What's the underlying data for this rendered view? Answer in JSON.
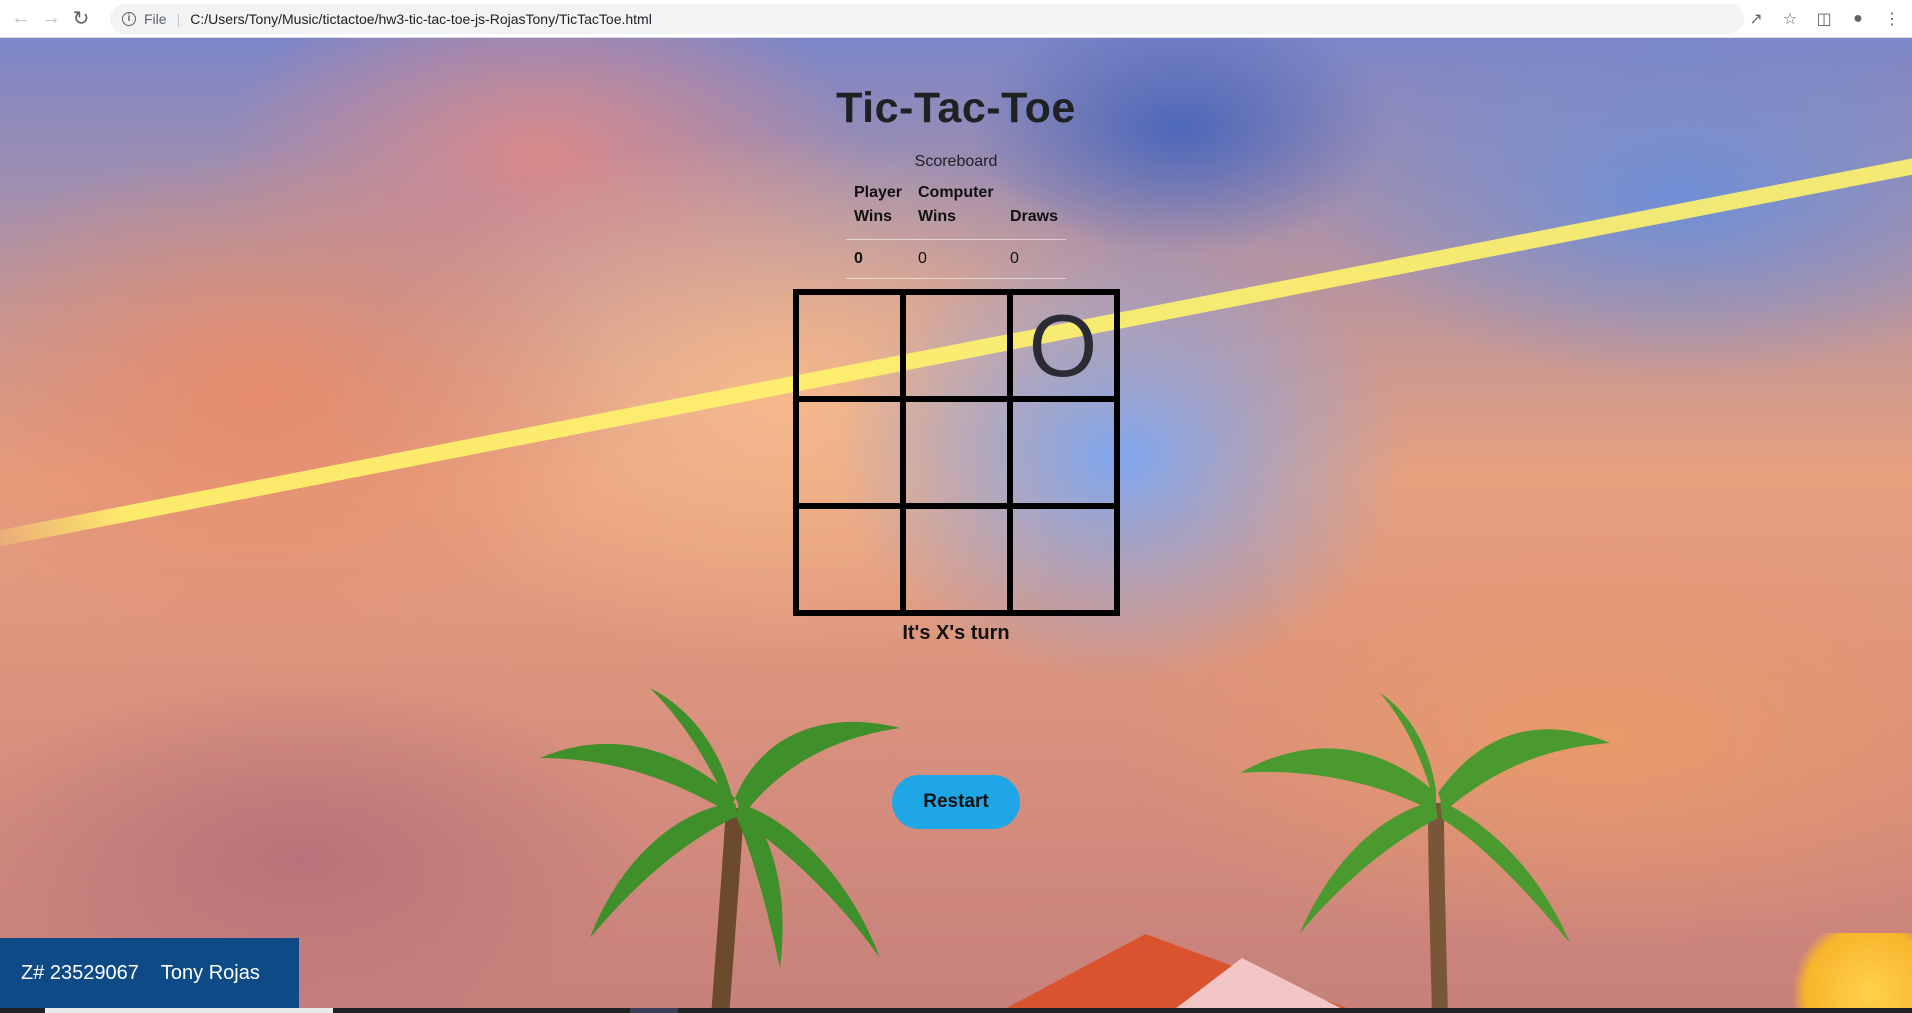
{
  "browser": {
    "scheme_label": "File",
    "url": "C:/Users/Tony/Music/tictactoe/hw3-tic-tac-toe-js-RojasTony/TicTacToe.html",
    "icons": [
      "back-arrow-icon",
      "forward-arrow-icon",
      "reload-icon",
      "info-icon",
      "share-icon",
      "star-icon",
      "side-panel-icon",
      "profile-icon",
      "kebab-menu-icon"
    ]
  },
  "game": {
    "title": "Tic-Tac-Toe",
    "scoreboard_caption": "Scoreboard",
    "headers": {
      "player_wins": "Player Wins",
      "computer_wins": "Computer Wins",
      "draws": "Draws"
    },
    "scores": {
      "player_wins": "0",
      "computer_wins": "0",
      "draws": "0"
    },
    "board": [
      "",
      "",
      "O",
      "",
      "",
      "",
      "",
      "",
      ""
    ],
    "status": "It's X's turn",
    "restart_label": "Restart"
  },
  "footer": {
    "zid": "Z# 23529067",
    "name": "Tony Rojas"
  },
  "colors": {
    "footer_bg": "#0d4a86",
    "restart_bg": "#1ea6e6",
    "board_line": "#000000"
  }
}
